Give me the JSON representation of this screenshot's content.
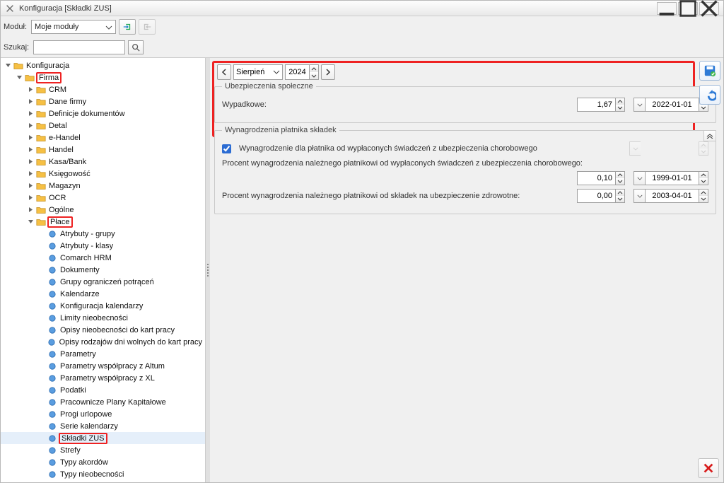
{
  "window": {
    "title": "Konfiguracja [Składki ZUS]"
  },
  "toolbar": {
    "module_label": "Moduł:",
    "module_value": "Moje moduły",
    "search_label": "Szukaj:",
    "search_value": ""
  },
  "tree": {
    "root": "Konfiguracja",
    "firma": "Firma",
    "firma_children": [
      "CRM",
      "Dane firmy",
      "Definicje dokumentów",
      "Detal",
      "e-Handel",
      "Handel",
      "Kasa/Bank",
      "Księgowość",
      "Magazyn",
      "OCR",
      "Ogólne"
    ],
    "place": "Płace",
    "place_children": [
      "Atrybuty - grupy",
      "Atrybuty - klasy",
      "Comarch HRM",
      "Dokumenty",
      "Grupy ograniczeń potrąceń",
      "Kalendarze",
      "Konfiguracja kalendarzy",
      "Limity nieobecności",
      "Opisy nieobecności do kart pracy",
      "Opisy rodzajów dni wolnych do kart pracy",
      "Parametry",
      "Parametry współpracy z Altum",
      "Parametry współpracy z XL",
      "Podatki",
      "Pracownicze Plany Kapitałowe",
      "Progi urlopowe",
      "Serie kalendarzy",
      "Składki ZUS",
      "Strefy",
      "Typy akordów",
      "Typy nieobecności"
    ],
    "selected": "Składki ZUS"
  },
  "dateNav": {
    "month": "Sierpień",
    "year": "2024"
  },
  "social": {
    "group_title": "Ubezpieczenia społeczne",
    "wypadkowe_label": "Wypadkowe:",
    "wypadkowe_value": "1,67",
    "wypadkowe_date": "2022-01-01"
  },
  "payer": {
    "group_title": "Wynagrodzenia płatnika składek",
    "chk_label": "Wynagrodzenie dla płatnika od wypłaconych świadczeń z ubezpieczenia chorobowego",
    "chk_checked": true,
    "row1_label": "Procent wynagrodzenia należnego płatnikowi od wypłaconych świadczeń z ubezpieczenia chorobowego:",
    "row1_value": "0,10",
    "row1_date": "1999-01-01",
    "row2_label": "Procent wynagrodzenia należnego płatnikowi od składek na ubezpieczenie zdrowotne:",
    "row2_value": "0,00",
    "row2_date": "2003-04-01"
  }
}
